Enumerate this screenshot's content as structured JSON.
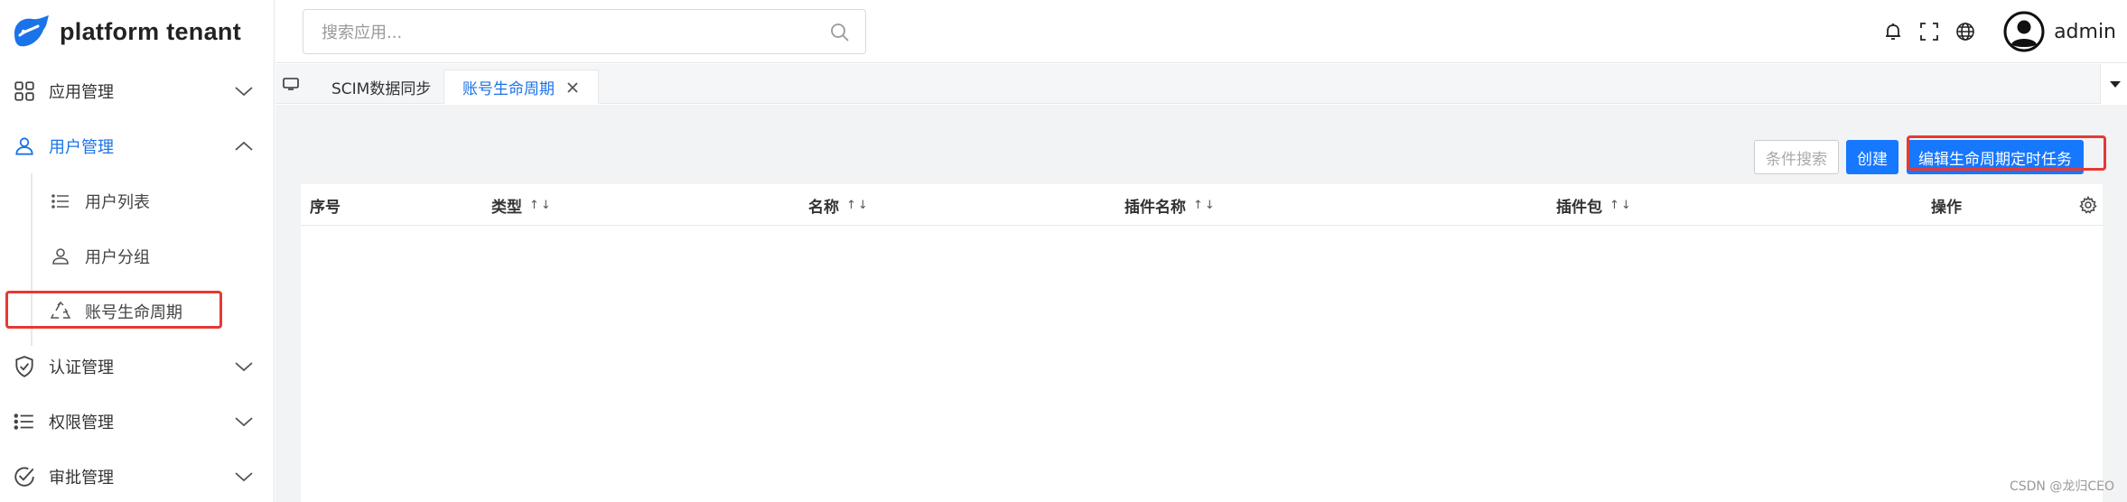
{
  "brand": {
    "name": "platform tenant"
  },
  "sidebar": {
    "items": [
      {
        "label": "应用管理",
        "icon": "grid-icon"
      },
      {
        "label": "用户管理",
        "icon": "user-icon"
      },
      {
        "label": "认证管理",
        "icon": "shield-check-icon"
      },
      {
        "label": "权限管理",
        "icon": "list-icon"
      },
      {
        "label": "审批管理",
        "icon": "check-circle-icon"
      }
    ],
    "sub_items": [
      {
        "label": "用户列表",
        "icon": "list-icon"
      },
      {
        "label": "用户分组",
        "icon": "user-icon"
      },
      {
        "label": "账号生命周期",
        "icon": "recycle-icon"
      }
    ]
  },
  "header": {
    "search_placeholder": "搜索应用...",
    "user": "admin"
  },
  "tabs": [
    {
      "label": "SCIM数据同步"
    },
    {
      "label": "账号生命周期"
    }
  ],
  "toolbar": {
    "search_label": "条件搜索",
    "create_label": "创建",
    "edit_label": "编辑生命周期定时任务"
  },
  "table": {
    "columns": [
      "序号",
      "类型",
      "名称",
      "插件名称",
      "插件包",
      "操作"
    ],
    "sort_glyph": "↑↓"
  },
  "watermark": "CSDN @龙归CEO",
  "colors": {
    "accent": "#1677ff",
    "highlight": "#e53935"
  }
}
